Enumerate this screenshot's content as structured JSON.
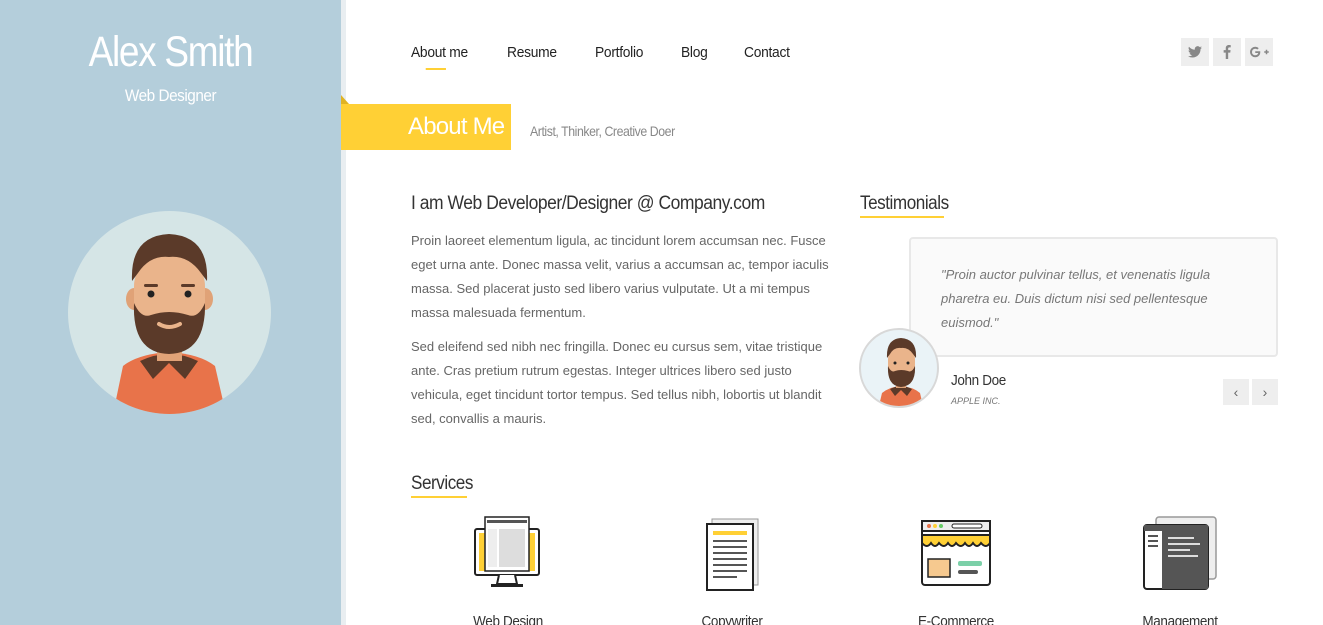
{
  "profile": {
    "name": "Alex Smith",
    "role": "Web Designer"
  },
  "nav": {
    "items": [
      {
        "label": "About me",
        "active": true
      },
      {
        "label": "Resume",
        "active": false
      },
      {
        "label": "Portfolio",
        "active": false
      },
      {
        "label": "Blog",
        "active": false
      },
      {
        "label": "Contact",
        "active": false
      }
    ]
  },
  "social": {
    "icons": [
      "twitter-icon",
      "facebook-icon",
      "google-plus-icon"
    ]
  },
  "section": {
    "title": "About Me",
    "subtitle": "Artist, Thinker, Creative Doer"
  },
  "about": {
    "heading": "I am Web Developer/Designer @ Company.com",
    "paragraphs": [
      "Proin laoreet elementum ligula, ac tincidunt lorem accumsan nec. Fusce eget urna ante. Donec massa velit, varius a accumsan ac, tempor iaculis massa. Sed placerat justo sed libero varius vulputate. Ut a mi tempus massa malesuada fermentum.",
      "Sed eleifend sed nibh nec fringilla. Donec eu cursus sem, vitae tristique ante. Cras pretium rutrum egestas. Integer ultrices libero sed justo vehicula, eget tincidunt tortor tempus. Sed tellus nibh, lobortis ut blandit sed, convallis a mauris."
    ]
  },
  "testimonials": {
    "heading": "Testimonials",
    "quote": "\"Proin auctor pulvinar tellus, et venenatis ligula pharetra eu. Duis dictum nisi sed pellentesque euismod.\"",
    "name": "John Doe",
    "company": "APPLE INC."
  },
  "services": {
    "heading": "Services",
    "items": [
      {
        "label": "Web Design",
        "icon": "monitor-icon"
      },
      {
        "label": "Copywriter",
        "icon": "document-icon"
      },
      {
        "label": "E-Commerce",
        "icon": "shop-icon"
      },
      {
        "label": "Management",
        "icon": "window-icon"
      }
    ]
  },
  "colors": {
    "sidebar": "#b4cedb",
    "accent": "#ffd035",
    "shirt": "#e8734a",
    "beard": "#5b3a29"
  }
}
